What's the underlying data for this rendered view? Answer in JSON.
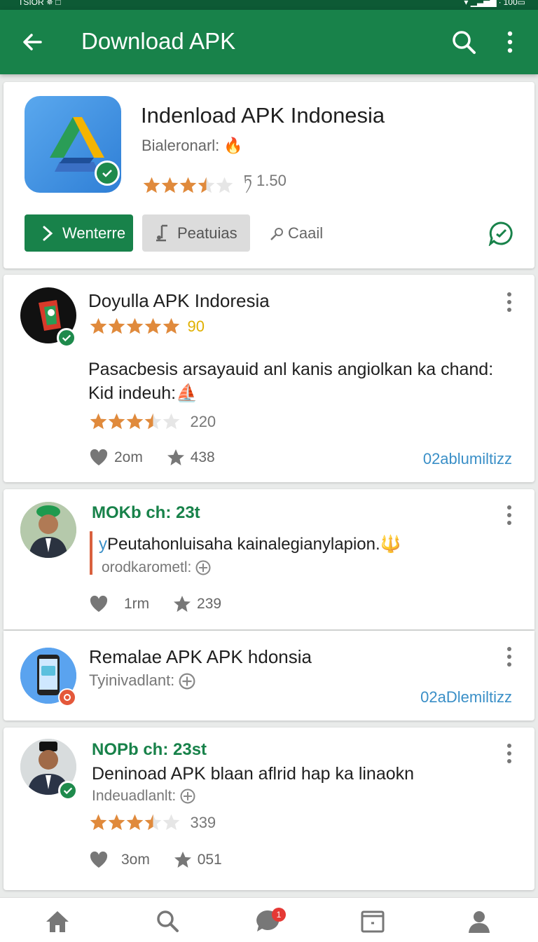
{
  "status_bar": {
    "left": "TSIOR  ✵  □",
    "right": "▾ ▁▃▅▇ ∙ 100▭"
  },
  "app_bar": {
    "title": "Download APK"
  },
  "hero": {
    "app_name": "Indenload APK Indonesia",
    "developer": "Bialeronarl:",
    "developer_emoji": "🔥",
    "rating": 3.5,
    "rating_text": "ཏ 1.50",
    "primary_button": "Wenterre",
    "secondary_button": "Peatuias",
    "text_button": "Caail"
  },
  "posts": [
    {
      "title": "Doyulla APK Indoresia",
      "rating_count": "90",
      "body": "Pasacbesis arsayauid anl kanis angiolkan ka chand: Kid indeuh:",
      "body_emoji": "⛵",
      "rating_count_2": "220",
      "likes": "2om",
      "stars": "438",
      "link": "02ablumiltizz"
    },
    {
      "title": "MOKb ch: 23t",
      "quote_prefix": "y",
      "quote": "Peutahonluisaha kainalegianylapion.",
      "quote_emoji": "🔱",
      "sub": "orodkarometl:",
      "likes": "1rm",
      "stars": "239"
    },
    {
      "title": "Remalae APK APK hdonsia",
      "sub": "Tyinivadlant:",
      "link": "02aDlemiltizz"
    },
    {
      "title": "NOPb ch: 23st",
      "headline": "Deninoad APK blaan aflrid hap ka linaokn",
      "sub": "Indeuadlanlt:",
      "rating_count": "339",
      "likes": "3om",
      "stars": "051"
    }
  ],
  "bottom_nav": {
    "badge": "1"
  },
  "colors": {
    "primary": "#18824a",
    "link": "#3a8fc7",
    "star": "#e08a3c"
  }
}
